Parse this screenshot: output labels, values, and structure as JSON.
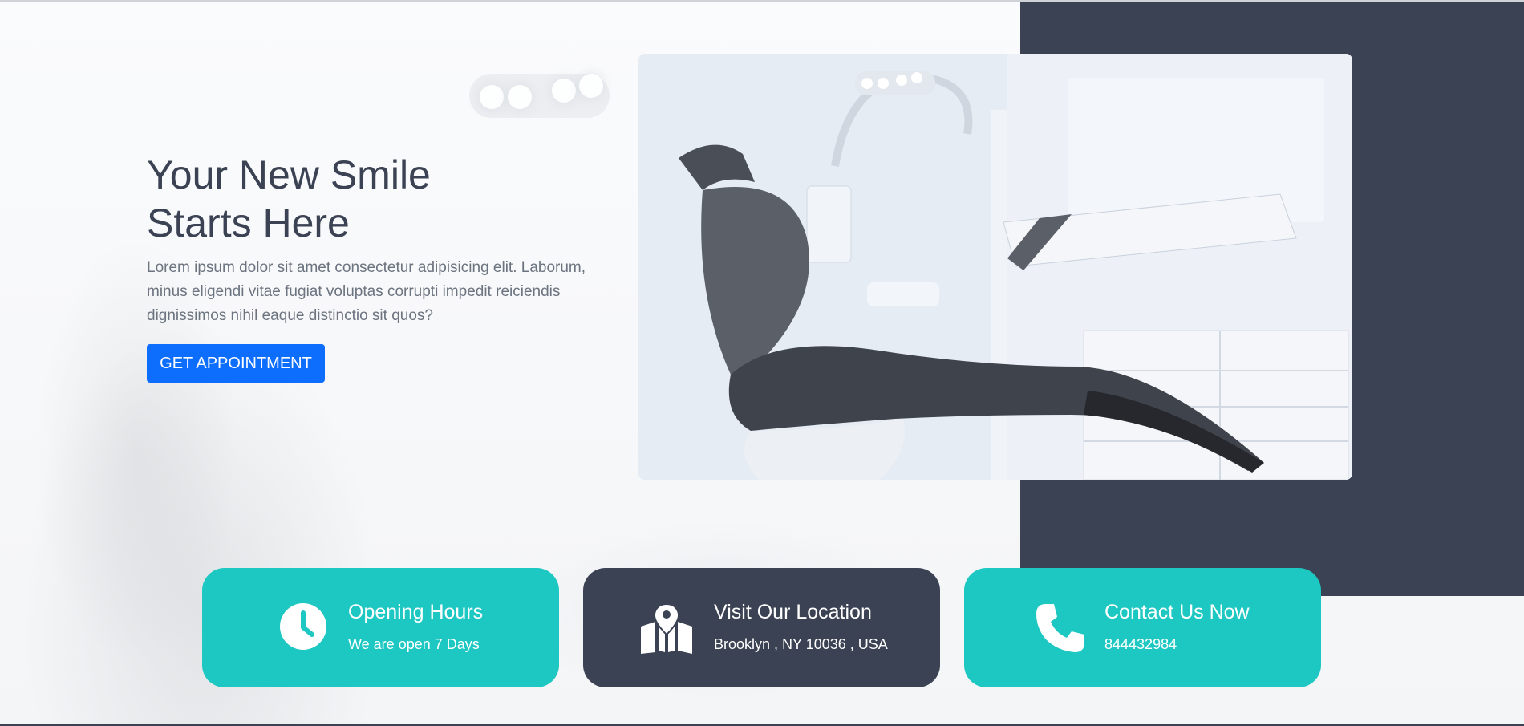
{
  "hero": {
    "title_line1": "Your New Smile",
    "title_line2": "Starts Here",
    "description": "Lorem ipsum dolor sit amet consectetur adipisicing elit. Laborum, minus eligendi vitae fugiat voluptas corrupti impedit reiciendis dignissimos nihil eaque distinctio sit quos?",
    "cta_label": "GET APPOINTMENT"
  },
  "info_cards": [
    {
      "title": "Opening Hours",
      "text": "We are open 7 Days",
      "icon": "clock-icon",
      "color": "#1dc7c2"
    },
    {
      "title": "Visit Our Location",
      "text": "Brooklyn , NY 10036 , USA",
      "icon": "map-location-icon",
      "color": "#3b4253"
    },
    {
      "title": "Contact Us Now",
      "text": "844432984",
      "icon": "phone-icon",
      "color": "#1dc7c2"
    }
  ],
  "colors": {
    "accent_teal": "#1dc7c2",
    "navy": "#3b4253",
    "button_blue": "#0d6efd",
    "heading": "#3b4253",
    "body_text": "#6c7480"
  }
}
